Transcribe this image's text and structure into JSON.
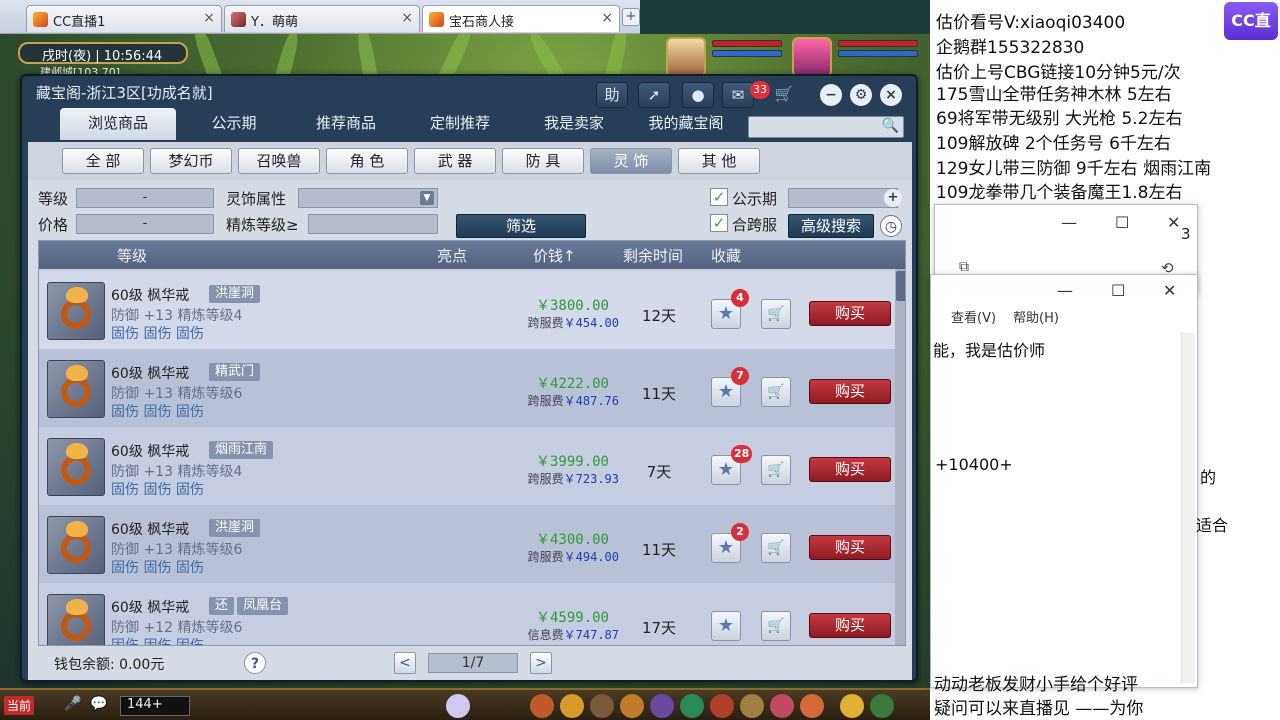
{
  "browser": {
    "tabs": [
      {
        "label": "CC直播1",
        "close": "×"
      },
      {
        "label": "Y．萌萌",
        "close": "×"
      },
      {
        "label": "宝石商人接",
        "close": "×"
      }
    ],
    "new_tab": "+"
  },
  "game": {
    "time": "戌时(夜) | 10:56:44",
    "coords": "建邺城[103,70]"
  },
  "cbg": {
    "title": "藏宝阁-浙江3区[功成名就]",
    "help": "助",
    "msg_count": "33",
    "nav_tabs": [
      "浏览商品",
      "公示期",
      "推荐商品",
      "定制推荐",
      "我是卖家",
      "我的藏宝阁"
    ],
    "categories": [
      "全 部",
      "梦幻币",
      "召唤兽",
      "角 色",
      "武 器",
      "防 具",
      "灵 饰",
      "其 他"
    ],
    "filters": {
      "level_label": "等级",
      "level_value": "-",
      "price_label": "价格",
      "price_value": "-",
      "attr_label": "灵饰属性",
      "refine_label": "精炼等级≥",
      "filter_btn": "筛选",
      "public_label": "公示期",
      "cross_label": "合跨服",
      "advanced_btn": "高级搜索"
    },
    "headers": {
      "level": "等级",
      "highlight": "亮点",
      "price": "价钱↑",
      "remain": "剩余时间",
      "fav": "收藏"
    },
    "items": [
      {
        "title": "60级 枫华戒",
        "tags": [
          "洪崖洞"
        ],
        "stat1": "防御 +13 精炼等级4",
        "stat2": "固伤 固伤 固伤",
        "price": "￥3800.00",
        "fee_label": "跨服费",
        "fee": "￥454.00",
        "remain": "12天",
        "fav": "4",
        "buy": "购买"
      },
      {
        "title": "60级 枫华戒",
        "tags": [
          "精武门"
        ],
        "stat1": "防御 +13 精炼等级6",
        "stat2": "固伤 固伤 固伤",
        "price": "￥4222.00",
        "fee_label": "跨服费",
        "fee": "￥487.76",
        "remain": "11天",
        "fav": "7",
        "buy": "购买"
      },
      {
        "title": "60级 枫华戒",
        "tags": [
          "烟雨江南"
        ],
        "stat1": "防御 +13 精炼等级4",
        "stat2": "固伤 固伤 固伤",
        "price": "￥3999.00",
        "fee_label": "跨服费",
        "fee": "￥723.93",
        "remain": "7天",
        "fav": "28",
        "buy": "购买"
      },
      {
        "title": "60级 枫华戒",
        "tags": [
          "洪崖洞"
        ],
        "stat1": "防御 +13 精炼等级6",
        "stat2": "固伤 固伤 固伤",
        "price": "￥4300.00",
        "fee_label": "跨服费",
        "fee": "￥494.00",
        "remain": "11天",
        "fav": "2",
        "buy": "购买"
      },
      {
        "title": "60级 枫华戒",
        "tags": [
          "还",
          "凤凰台"
        ],
        "stat1": "防御 +12 精炼等级6",
        "stat2": "固伤 固伤 固伤",
        "price": "￥4599.00",
        "fee_label": "信息费",
        "fee": "￥747.87",
        "remain": "17天",
        "fav": "",
        "buy": "购买"
      }
    ],
    "wallet": "钱包余额: 0.00元",
    "help_q": "?",
    "page": "1/7",
    "prev": "<",
    "next": ">"
  },
  "gamebar": {
    "channel": "当前",
    "count": "144+"
  },
  "stream": {
    "lines": [
      "估价看号V:xiaoqi03400",
      "企鹅群155322830",
      "估价上号CBG链接10分钟5元/次",
      "175雪山全带任务神木林 5左右",
      "69将军带无级别 大光枪 5.2左右",
      "109解放碑 2个任务号 6千左右",
      "129女儿带三防御 9千左右 烟雨江南",
      "109龙拳带几个装备魔王1.8左右"
    ],
    "logo": "CC直播",
    "window_menu": [
      "查看(V)",
      "帮助(H)"
    ],
    "notepad_lines": [
      "能，我是估价师",
      "+10400+",
      "动动老板发财小手给个好评",
      "疑问可以来直播见 ——为你"
    ],
    "side_fragments": [
      "3",
      "的",
      "适合"
    ]
  }
}
